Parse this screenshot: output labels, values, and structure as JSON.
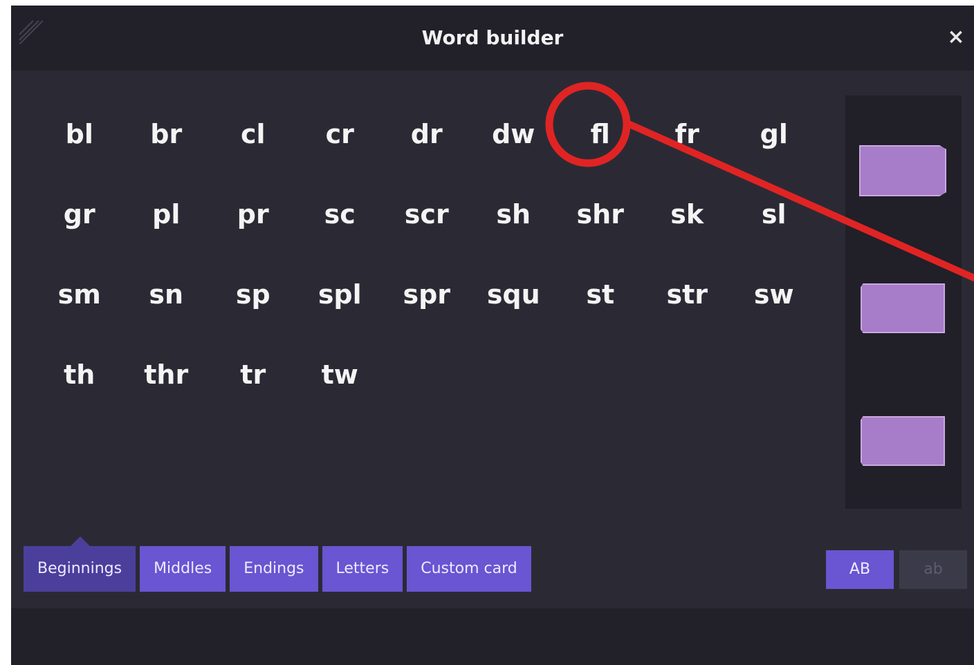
{
  "window": {
    "title": "Word builder",
    "close_glyph": "×"
  },
  "tiles": [
    "bl",
    "br",
    "cl",
    "cr",
    "dr",
    "dw",
    "fl",
    "fr",
    "gl",
    "gr",
    "pl",
    "pr",
    "sc",
    "scr",
    "sh",
    "shr",
    "sk",
    "sl",
    "sm",
    "sn",
    "sp",
    "spl",
    "spr",
    "squ",
    "st",
    "str",
    "sw",
    "th",
    "thr",
    "tr",
    "tw"
  ],
  "highlighted_tile": "fl",
  "card_slots": [
    {
      "name": "card-slot-1"
    },
    {
      "name": "card-slot-2"
    },
    {
      "name": "card-slot-3"
    }
  ],
  "tabs": [
    {
      "label": "Beginnings",
      "active": true
    },
    {
      "label": "Middles",
      "active": false
    },
    {
      "label": "Endings",
      "active": false
    },
    {
      "label": "Letters",
      "active": false
    },
    {
      "label": "Custom card",
      "active": false
    }
  ],
  "case_toggle": {
    "upper_label": "AB",
    "lower_label": "ab",
    "selected": "AB"
  },
  "colors": {
    "window_bg": "#2b2a34",
    "titlebar_bg": "#22212a",
    "tab_active": "#4b3f9c",
    "tab": "#6a55d2",
    "card": "#a77dc9",
    "annotation_red": "#e02424"
  },
  "icons": {
    "close": "close-icon",
    "grip": "resize-grip-icon"
  }
}
